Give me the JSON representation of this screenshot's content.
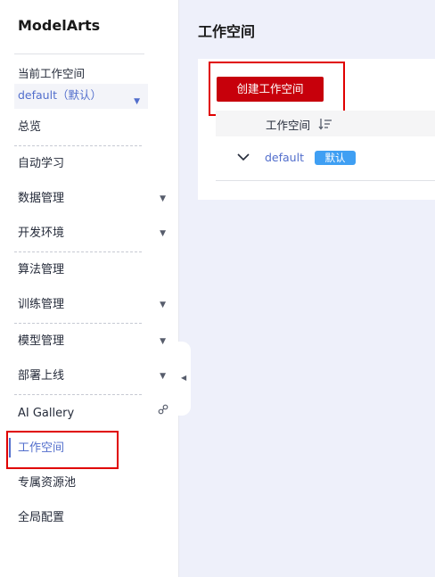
{
  "app": {
    "name": "ModelArts"
  },
  "workspace_selector": {
    "label": "当前工作空间",
    "value": "default（默认）"
  },
  "sidebar": {
    "items": [
      {
        "label": "总览"
      },
      {
        "label": "自动学习"
      },
      {
        "label": "数据管理"
      },
      {
        "label": "开发环境"
      },
      {
        "label": "算法管理"
      },
      {
        "label": "训练管理"
      },
      {
        "label": "模型管理"
      },
      {
        "label": "部署上线"
      },
      {
        "label": "AI Gallery"
      },
      {
        "label": "工作空间"
      },
      {
        "label": "专属资源池"
      },
      {
        "label": "全局配置"
      }
    ],
    "active": "工作空间"
  },
  "page": {
    "title": "工作空间",
    "create_button": "创建工作空间"
  },
  "table": {
    "columns": [
      "工作空间"
    ],
    "rows": [
      {
        "name": "default",
        "badge": "默认"
      }
    ]
  },
  "colors": {
    "accent": "#526ecc",
    "primary_button": "#c7000b",
    "badge": "#3f9ff3",
    "highlight_box": "#e00000"
  },
  "icons": {
    "sort": "sort-descending-icon",
    "expand": "chevron-down-icon",
    "external": "link-icon",
    "collapse": "caret-left-icon"
  }
}
